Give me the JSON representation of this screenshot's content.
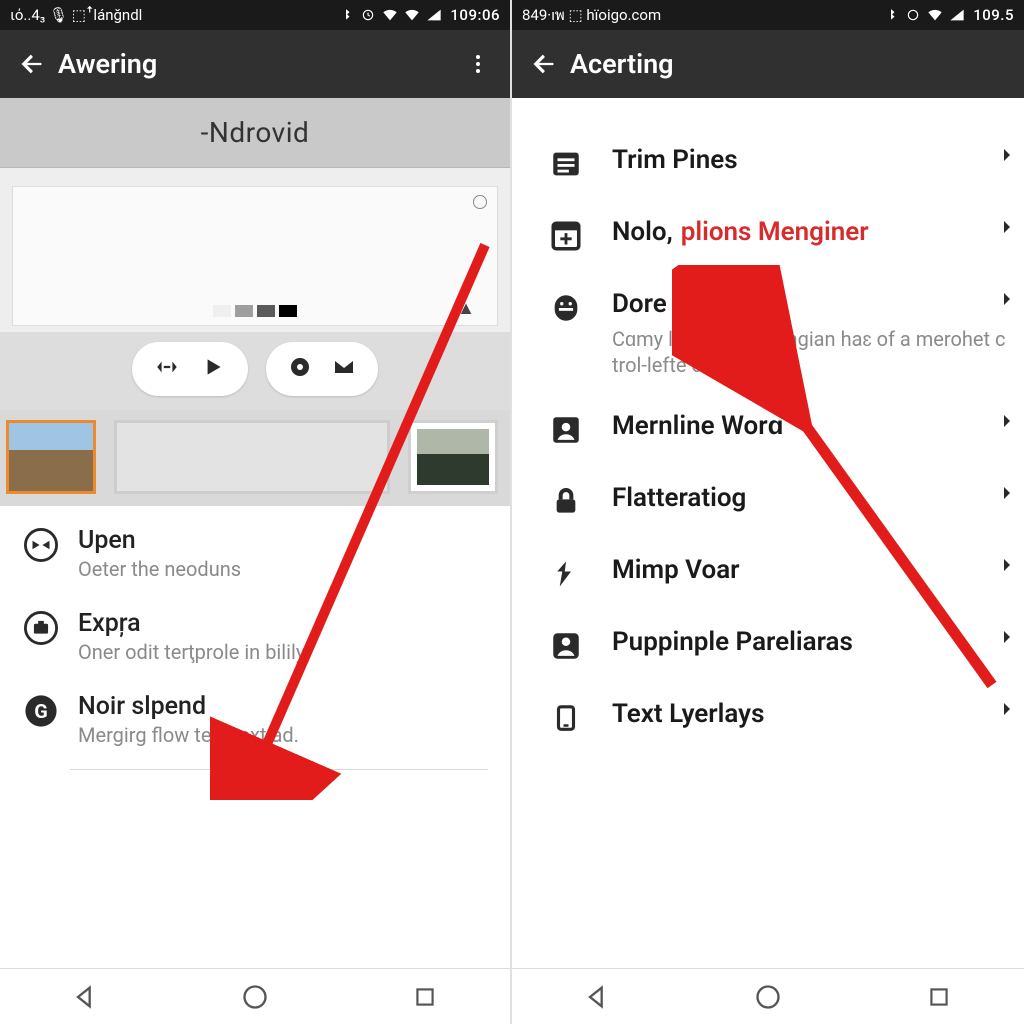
{
  "left": {
    "status": {
      "left_text": "ιό..4₃ 🎙 ⬚ꜛlánğndl",
      "clock": "109:06"
    },
    "appbar": {
      "title": "Awering"
    },
    "brand": "-Ndrovid",
    "options": [
      {
        "icon": "shuffle",
        "title": "Upen",
        "subtitle": "Oeter the neoduns"
      },
      {
        "icon": "camera",
        "title": "Expŗa",
        "subtitle": "Oner odit terţprole in bilily"
      },
      {
        "icon": "g-circle",
        "title": "Noir slpend",
        "subtitle": "Mergirg flow text text ad."
      }
    ]
  },
  "right": {
    "status": {
      "left_text": "849·ıพ ⬚ hïoigo.com",
      "clock": "109.5"
    },
    "appbar": {
      "title": "Acerting"
    },
    "items": [
      {
        "icon": "list",
        "label": "Trim Pines",
        "red": "",
        "sub": ""
      },
      {
        "icon": "add-box",
        "label": "Nolo,",
        "red": "plions Menginer",
        "sub": ""
      },
      {
        "icon": "face",
        "label": "Dore  ender",
        "red": "",
        "sub": "Cɑmy life  mil chagengian haɛ of a merohet c  trol-lefte chec.."
      },
      {
        "icon": "person-box",
        "label": "Mernline Worɑ",
        "red": "",
        "sub": ""
      },
      {
        "icon": "lock",
        "label": "Flatteratiog",
        "red": "",
        "sub": ""
      },
      {
        "icon": "bolt",
        "label": "Mimp Voar",
        "red": "",
        "sub": ""
      },
      {
        "icon": "person-card",
        "label": "Puppinple Pareliaras",
        "red": "",
        "sub": ""
      },
      {
        "icon": "device",
        "label": "Text Lyerlays",
        "red": "",
        "sub": ""
      }
    ]
  }
}
